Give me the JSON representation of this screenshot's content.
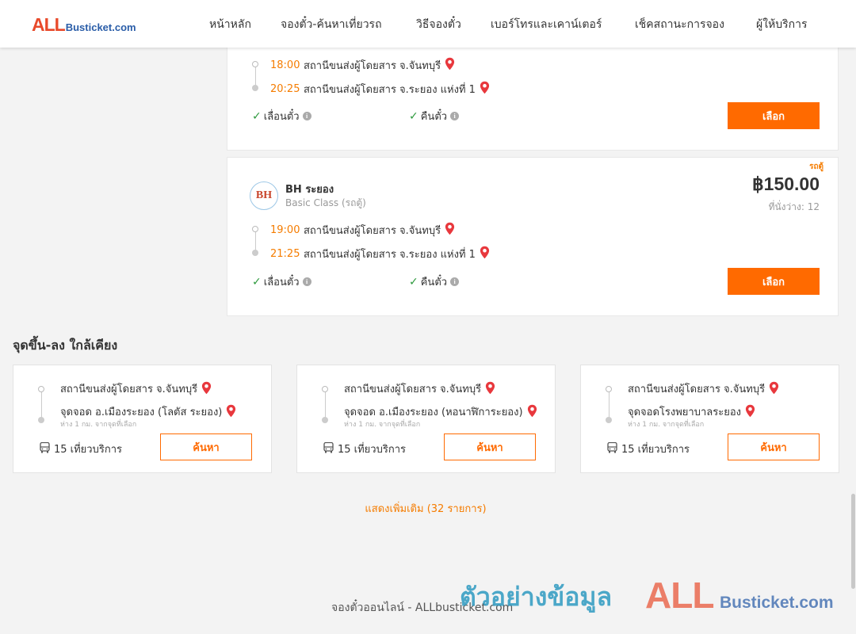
{
  "header": {
    "logo_all": "ALL",
    "logo_rest": "Busticket.com",
    "nav": [
      "หน้าหลัก",
      "จองตั๋ว-ค้นหาเที่ยวรถ",
      "วิธีจองตั๋ว",
      "เบอร์โทรและเคาน์เตอร์",
      "เช็คสถานะการจอง",
      "ผู้ให้บริการ"
    ]
  },
  "trips": [
    {
      "depart_time": "18:00",
      "depart_station": "สถานีขนส่งผู้โดยสาร จ.จันทบุรี",
      "arrive_time": "20:25",
      "arrive_station": "สถานีขนส่งผู้โดยสาร จ.ระยอง แห่งที่ 1",
      "feature_1": "เลื่อนตั๋ว",
      "feature_2": "คืนตั๋ว",
      "select_label": "เลือก"
    },
    {
      "badge": "รถตู้",
      "operator_logo": "BH",
      "operator_name": "BH ระยอง",
      "operator_class": "Basic Class (รถตู้)",
      "price": "฿150.00",
      "seats": "ที่นั่งว่าง: 12",
      "depart_time": "19:00",
      "depart_station": "สถานีขนส่งผู้โดยสาร จ.จันทบุรี",
      "arrive_time": "21:25",
      "arrive_station": "สถานีขนส่งผู้โดยสาร จ.ระยอง แห่งที่ 1",
      "feature_1": "เลื่อนตั๋ว",
      "feature_2": "คืนตั๋ว",
      "select_label": "เลือก"
    }
  ],
  "nearby": {
    "title": "จุดขึ้น-ลง ใกล้เคียง",
    "items": [
      {
        "from": "สถานีขนส่งผู้โดยสาร จ.จันทบุรี",
        "to": "จุดจอด อ.เมืองระยอง (โลตัส ระยอง)",
        "distance": "ห่าง 1 กม. จากจุดที่เลือก",
        "trips": "15 เที่ยวบริการ",
        "search_label": "ค้นหา"
      },
      {
        "from": "สถานีขนส่งผู้โดยสาร จ.จันทบุรี",
        "to": "จุดจอด อ.เมืองระยอง (หอนาฬิการะยอง)",
        "distance": "ห่าง 1 กม. จากจุดที่เลือก",
        "trips": "15 เที่ยวบริการ",
        "search_label": "ค้นหา"
      },
      {
        "from": "สถานีขนส่งผู้โดยสาร จ.จันทบุรี",
        "to": "จุดจอดโรงพยาบาลระยอง",
        "distance": "ห่าง 1 กม. จากจุดที่เลือก",
        "trips": "15 เที่ยวบริการ",
        "search_label": "ค้นหา"
      }
    ]
  },
  "show_more": "แสดงเพิ่มเติม (32 รายการ)",
  "footer": {
    "text": "จองตั๋วออนไลน์ - ALLbusticket.com"
  },
  "watermark": {
    "thai": "ตัวอย่างข้อมูล",
    "all": "ALL",
    "rest": "Busticket.com"
  },
  "colors": {
    "accent": "#ff6a00",
    "time": "#f57c00",
    "check": "#2e9a3e",
    "pin": "#e8383d"
  }
}
